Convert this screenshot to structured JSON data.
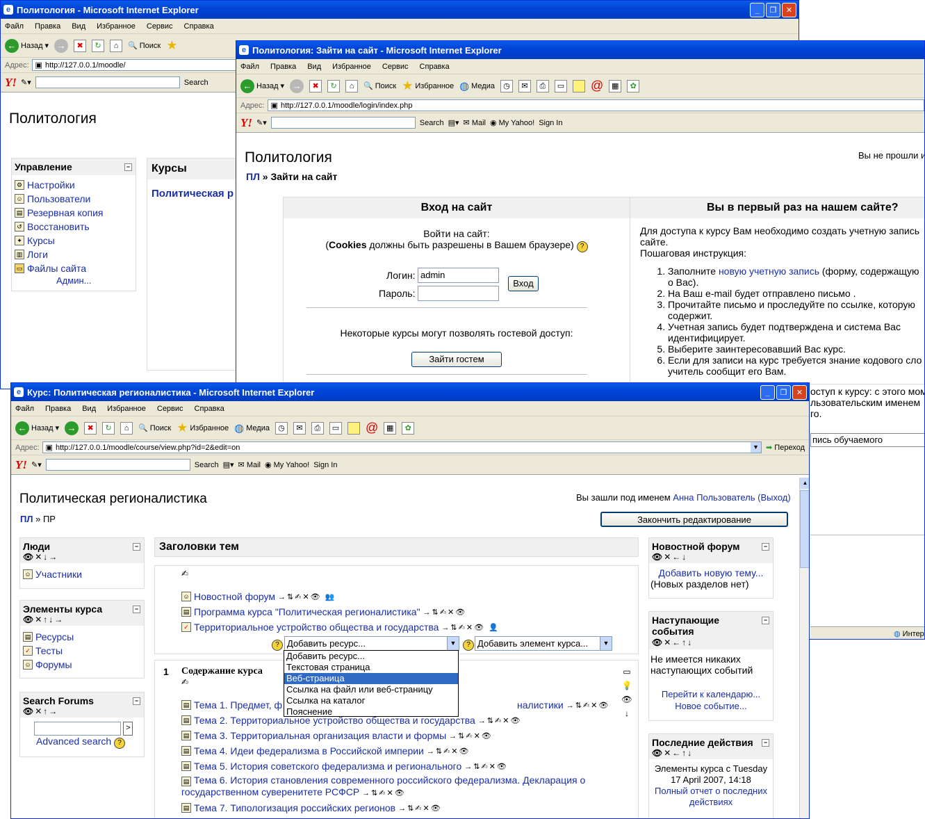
{
  "browser": {
    "menu": [
      "Файл",
      "Правка",
      "Вид",
      "Избранное",
      "Сервис",
      "Справка"
    ],
    "back": "Назад",
    "search": "Поиск",
    "favorites": "Избранное",
    "media": "Медиа",
    "address_label": "Адрес:",
    "go": "Переход",
    "yahoo": {
      "logo": "Y!",
      "search": "Search",
      "mail": "Mail",
      "my_yahoo": "My Yahoo!",
      "sign_in": "Sign In"
    }
  },
  "win1": {
    "title": "Политология - Microsoft Internet Explorer",
    "url": "http://127.0.0.1/moodle/",
    "site_title": "Политология",
    "admin_block": {
      "title": "Управление",
      "items": [
        "Настройки",
        "Пользователи",
        "Резервная копия",
        "Восстановить",
        "Курсы",
        "Логи",
        "Файлы сайта"
      ],
      "more": "Админ..."
    },
    "courses_title": "Курсы",
    "course_link": "Политическая р"
  },
  "win2": {
    "title": "Политология: Зайти на сайт - Microsoft Internet Explorer",
    "url": "http://127.0.0.1/moodle/login/index.php",
    "site_title": "Политология",
    "not_logged": "Вы не прошли и",
    "breadcrumb_home": "ПЛ",
    "breadcrumb_sep": "»",
    "breadcrumb_current": "Зайти на сайт",
    "login_header": "Вход на сайт",
    "first_time_header": "Вы в первый раз на нашем сайте?",
    "login_prompt": "Войти на сайт:",
    "cookies_pre": "(",
    "cookies_bold": "Cookies",
    "cookies_post": " должны быть разрешены в Вашем браузере)",
    "login_label": "Логин:",
    "login_value": "admin",
    "password_label": "Пароль:",
    "login_button": "Вход",
    "guest_text": "Некоторые курсы могут позволять гостевой доступ:",
    "guest_button": "Зайти гостем",
    "intro": "Для доступа к курсу Вам необходимо создать учетную запись сайте.",
    "instructions_title": "Пошаговая инструкция:",
    "steps": [
      {
        "pre": "Заполните ",
        "link": "новую учетную запись",
        "post": " (форму, содержащую о Вас)."
      },
      {
        "pre": "На Ваш e-mail будет отправлено письмо .",
        "link": "",
        "post": ""
      },
      {
        "pre": "Прочитайте письмо и проследуйте по ссылке, которую содержит.",
        "link": "",
        "post": ""
      },
      {
        "pre": "Учетная запись будет подтверждена и система Вас идентифицирует.",
        "link": "",
        "post": ""
      },
      {
        "pre": "Выберите заинтересовавший Вас курс.",
        "link": "",
        "post": ""
      },
      {
        "pre": "Если для записи на курс требуется знание кодового сло учитель сообщит его Вам.",
        "link": "",
        "post": ""
      }
    ],
    "tail1": "оступ к курсу: с этого мом",
    "tail2": "льзовательским именем",
    "tail3": "го.",
    "tail_button": "пись обучаемого",
    "status_zone": "Интер"
  },
  "win3": {
    "title": "Курс: Политическая регионалистика - Microsoft Internet Explorer",
    "url": "http://127.0.0.1/moodle/course/view.php?id=2&edit=on",
    "course_title": "Политическая регионалистика",
    "logged_in_pre": "Вы зашли под именем ",
    "logged_in_user": "Анна Пользователь",
    "logout": "(Выход)",
    "breadcrumb_home": "ПЛ",
    "breadcrumb_sep": "»",
    "breadcrumb_current": "ПР",
    "end_edit_button": "Закончить редактирование",
    "people_block": {
      "title": "Люди",
      "item": "Участники"
    },
    "elements_block": {
      "title": "Элементы курса",
      "items": [
        "Ресурсы",
        "Тесты",
        "Форумы"
      ]
    },
    "search_block": {
      "title": "Search Forums",
      "go": ">",
      "advanced": "Advanced search"
    },
    "topics_title": "Заголовки тем",
    "topic0_items": [
      "Новостной форум",
      "Программа курса \"Политическая регионалистика\"",
      "Территориальное устройство общества и государства"
    ],
    "add_resource": "Добавить ресурс...",
    "add_activity": "Добавить элемент курса...",
    "dropdown": [
      "Добавить ресурс...",
      "Текстовая страница",
      "Веб-страница",
      "Ссылка на файл или веб-страницу",
      "Ссылка на каталог",
      "Пояснение"
    ],
    "dropdown_selected": 2,
    "section1_num": "1",
    "section1_title": "Содержание курса",
    "section1_items": [
      "Тема 1. Предмет, ф",
      "Тема 2. Территориальное устройство общества и государства",
      "Тема 3. Территориальная организация власти и формы",
      "Тема 4. Идеи федерализма в Российской империи",
      "Тема 5. История советского федерализма и регионального",
      "Тема 6. История становления современного российского федерализма. Декларация о государственном суверенитете РСФСР",
      "Тема 7. Типологизация российских регионов"
    ],
    "section1_item1_tail": "налистики",
    "news_block": {
      "title": "Новостной форум",
      "add": "Добавить новую тему...",
      "none": "(Новых разделов нет)"
    },
    "events_block": {
      "title": "Наступающие события",
      "none": "Не имеется никаких наступающих событий",
      "calendar": "Перейти к календарю...",
      "new": "Новое событие..."
    },
    "recent_block": {
      "title": "Последние действия",
      "since": "Элементы курса с Tuesday 17 April 2007, 14:18",
      "full": "Полный отчет о последних действиях"
    }
  },
  "colors": {
    "titlebar": "#0045d8",
    "link": "#1a2ea8",
    "chrome": "#ece9d8",
    "highlight": "#316ac5"
  }
}
